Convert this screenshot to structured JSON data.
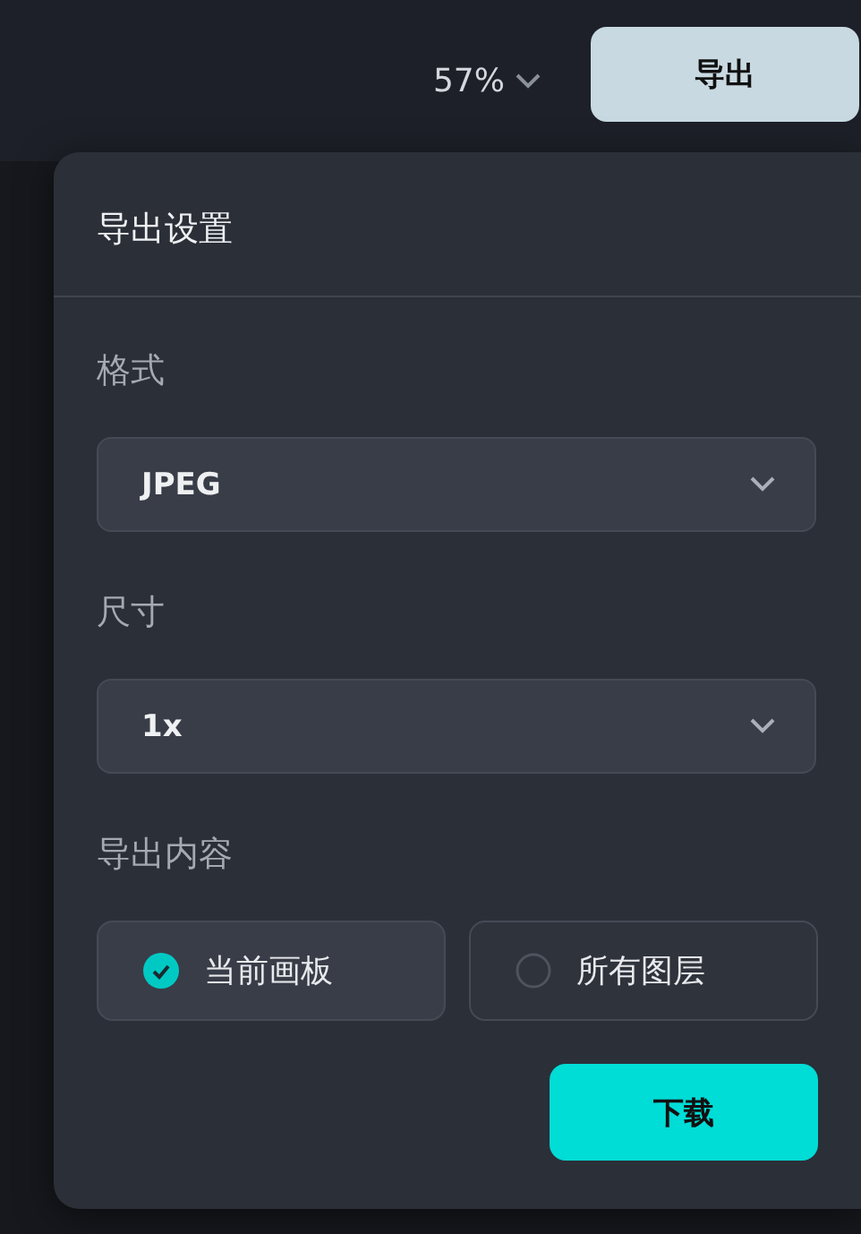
{
  "toolbar": {
    "zoom": "57%",
    "export_button": "导出"
  },
  "export_panel": {
    "title": "导出设置",
    "fields": [
      {
        "label": "格式",
        "value": "JPEG"
      },
      {
        "label": "尺寸",
        "value": "1x"
      }
    ],
    "content": {
      "label": "导出内容",
      "options": [
        {
          "label": "当前画板",
          "selected": true
        },
        {
          "label": "所有图层",
          "selected": false
        }
      ]
    },
    "download_button": "下载"
  }
}
